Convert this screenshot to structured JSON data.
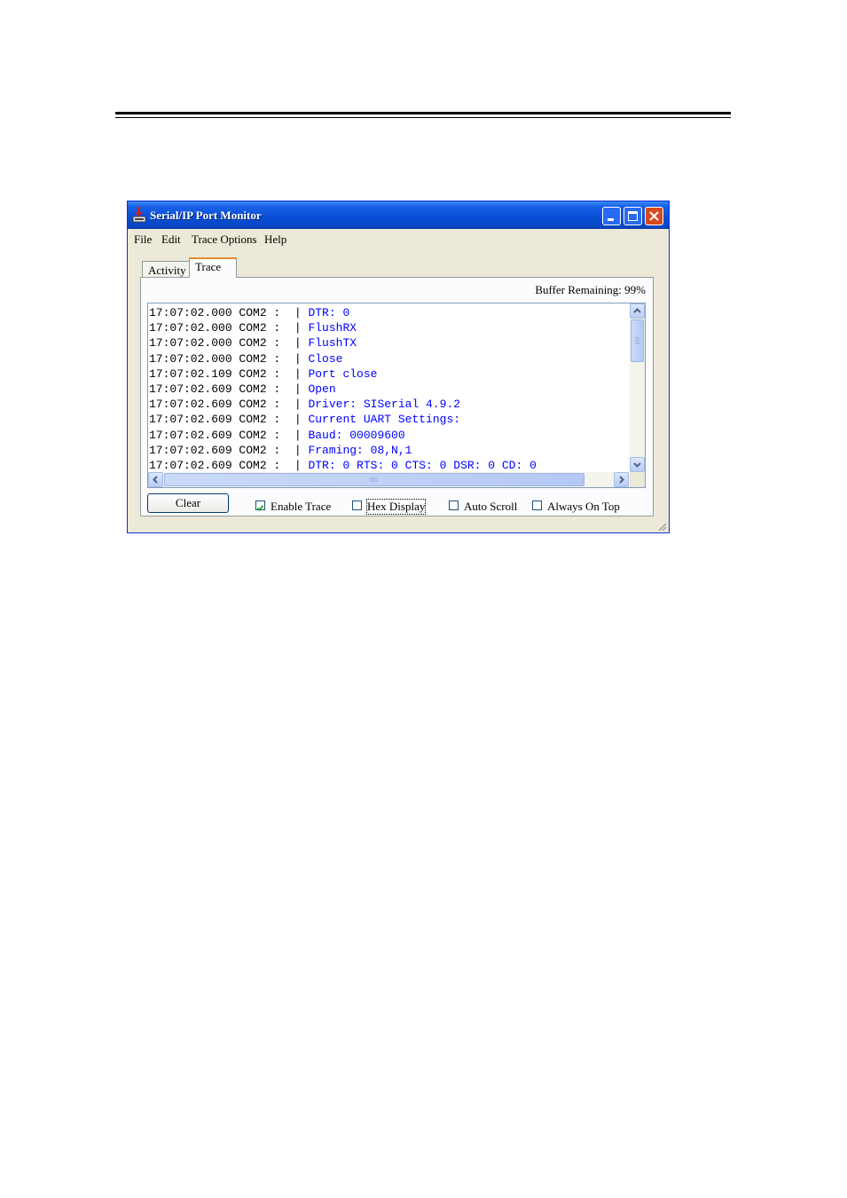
{
  "window": {
    "title": "Serial/IP Port Monitor",
    "accent": "#0a4fd8",
    "close_color": "#d9481e"
  },
  "menu": {
    "file": "File",
    "edit": "Edit",
    "trace_options": "Trace Options",
    "help": "Help"
  },
  "tabs": {
    "activity": "Activity",
    "trace": "Trace",
    "selected": "Trace"
  },
  "buffer": {
    "label": "Buffer Remaining: 99%"
  },
  "trace": {
    "rows": [
      {
        "timestamp": "17:07:02.000",
        "port": "COM2",
        "message": "DTR: 0"
      },
      {
        "timestamp": "17:07:02.000",
        "port": "COM2",
        "message": "FlushRX"
      },
      {
        "timestamp": "17:07:02.000",
        "port": "COM2",
        "message": "FlushTX"
      },
      {
        "timestamp": "17:07:02.000",
        "port": "COM2",
        "message": "Close"
      },
      {
        "timestamp": "17:07:02.109",
        "port": "COM2",
        "message": "Port close"
      },
      {
        "timestamp": "17:07:02.609",
        "port": "COM2",
        "message": "Open"
      },
      {
        "timestamp": "17:07:02.609",
        "port": "COM2",
        "message": "Driver: SISerial 4.9.2"
      },
      {
        "timestamp": "17:07:02.609",
        "port": "COM2",
        "message": "Current UART Settings:"
      },
      {
        "timestamp": "17:07:02.609",
        "port": "COM2",
        "message": "Baud: 00009600"
      },
      {
        "timestamp": "17:07:02.609",
        "port": "COM2",
        "message": "Framing: 08,N,1"
      },
      {
        "timestamp": "17:07:02.609",
        "port": "COM2",
        "message": "DTR: 0 RTS: 0 CTS: 0 DSR: 0 CD: 0"
      }
    ],
    "message_color": "#0000ff"
  },
  "controls": {
    "clear": "Clear",
    "enable_trace": {
      "label": "Enable Trace",
      "checked": true
    },
    "hex_display": {
      "label": "Hex Display",
      "checked": false
    },
    "auto_scroll": {
      "label": "Auto Scroll",
      "checked": false
    },
    "always_on_top": {
      "label": "Always On Top",
      "checked": false
    }
  }
}
